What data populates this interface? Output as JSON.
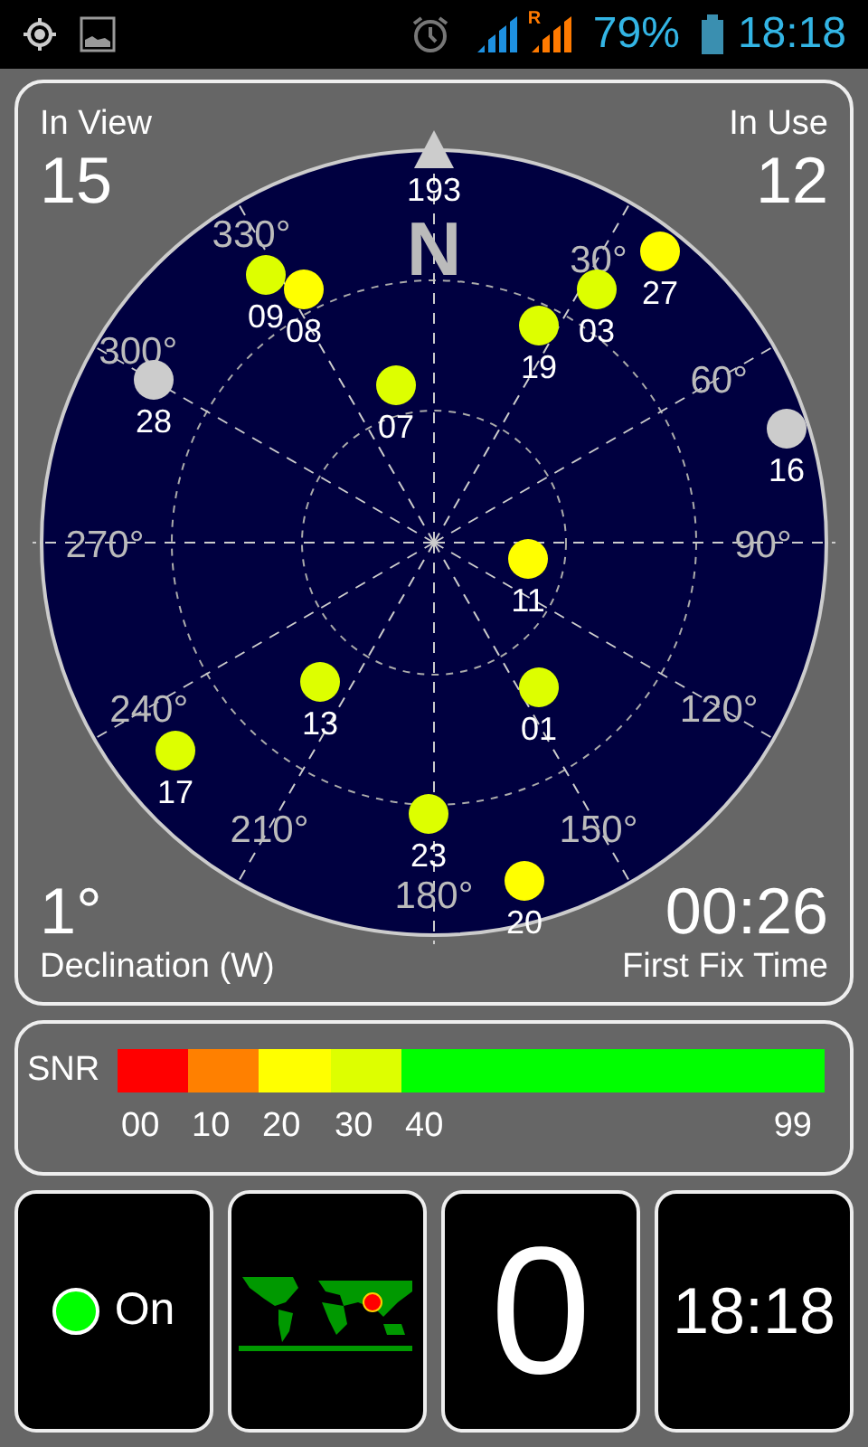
{
  "status_bar": {
    "roaming": "R",
    "battery": "79%",
    "time": "18:18"
  },
  "sky": {
    "in_view_label": "In View",
    "in_view": "15",
    "in_use_label": "In Use",
    "in_use": "12",
    "north": "N",
    "azimuths": [
      "30°",
      "60°",
      "90°",
      "120°",
      "150°",
      "180°",
      "210°",
      "240°",
      "270°",
      "300°",
      "330°"
    ],
    "satellites": [
      {
        "id": "193",
        "kind": "label"
      },
      {
        "id": "09",
        "kind": "dot",
        "color": "#ddff00"
      },
      {
        "id": "08",
        "kind": "dot",
        "color": "#ffff00"
      },
      {
        "id": "27",
        "kind": "dot",
        "color": "#ffff00"
      },
      {
        "id": "03",
        "kind": "dot",
        "color": "#ddff00"
      },
      {
        "id": "19",
        "kind": "dot",
        "color": "#ddff00"
      },
      {
        "id": "28",
        "kind": "dot",
        "color": "#cccccc"
      },
      {
        "id": "07",
        "kind": "dot",
        "color": "#ddff00"
      },
      {
        "id": "16",
        "kind": "dot",
        "color": "#cccccc"
      },
      {
        "id": "11",
        "kind": "dot",
        "color": "#ffff00"
      },
      {
        "id": "13",
        "kind": "dot",
        "color": "#ddff00"
      },
      {
        "id": "01",
        "kind": "dot",
        "color": "#ddff00"
      },
      {
        "id": "17",
        "kind": "dot",
        "color": "#ddff00"
      },
      {
        "id": "23",
        "kind": "dot",
        "color": "#ddff00"
      },
      {
        "id": "20",
        "kind": "dot",
        "color": "#ffff00"
      }
    ],
    "declination": "1°",
    "declination_label": "Declination (W)",
    "fix_time": "00:26",
    "fix_time_label": "First Fix Time"
  },
  "snr": {
    "label": "SNR",
    "ticks": [
      "00",
      "10",
      "20",
      "30",
      "40",
      "99"
    ]
  },
  "tiles": {
    "gps": {
      "on": true,
      "label": "On"
    },
    "count": "0",
    "clock": "18:18"
  }
}
